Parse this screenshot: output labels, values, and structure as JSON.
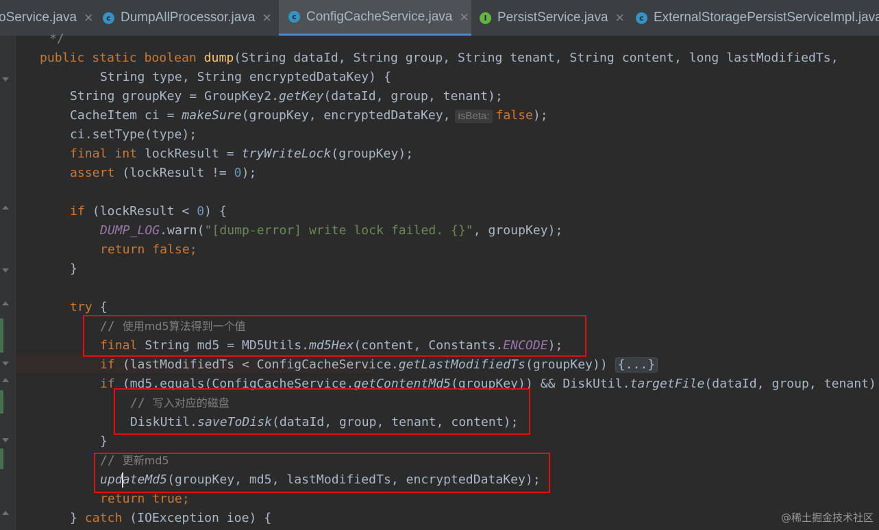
{
  "tabs": [
    {
      "name": "oService.java",
      "icon": "class-icon",
      "active": false
    },
    {
      "name": "DumpAllProcessor.java",
      "icon": "class-icon",
      "active": false
    },
    {
      "name": "ConfigCacheService.java",
      "icon": "class-icon",
      "active": true
    },
    {
      "name": "PersistService.java",
      "icon": "interface-icon",
      "active": false
    },
    {
      "name": "ExternalStoragePersistServiceImpl.java",
      "icon": "class-icon",
      "active": false
    }
  ],
  "icons": {
    "class_letter": "c",
    "interface_letter": "I",
    "close_glyph": "×"
  },
  "code": {
    "l0": "*/",
    "l1_kw": "public static boolean ",
    "l1_fn": "dump",
    "l1_rest": "(String dataId, String group, String tenant, String content, long lastModifiedTs,",
    "l2": "String type, String encryptedDataKey) {",
    "l3_a": "String groupKey = GroupKey2.",
    "l3_fn": "getKey",
    "l3_b": "(dataId, group, tenant);",
    "l4_a": "CacheItem ci = ",
    "l4_fn": "makeSure",
    "l4_b": "(groupKey, encryptedDataKey,",
    "l4_hint": "isBeta:",
    "l4_val": "false",
    "l4_end": ");",
    "l5": "ci.setType(type);",
    "l6_kw": "final int ",
    "l6_a": "lockResult = ",
    "l6_fn": "tryWriteLock",
    "l6_b": "(groupKey);",
    "l7_kw": "assert ",
    "l7_a": "(lockResult != ",
    "l7_num": "0",
    "l7_b": ");",
    "l8_kw": "if ",
    "l8_a": "(lockResult < ",
    "l8_num": "0",
    "l8_b": ") {",
    "l9_field": "DUMP_LOG",
    "l9_a": ".warn(",
    "l9_str": "\"[dump-error] write lock failed. {}\"",
    "l9_b": ", groupKey);",
    "l10_kw": "return false",
    "l10_b": ";",
    "l11": "}",
    "l12_kw": "try ",
    "l12_b": "{",
    "l13_cm": "// ",
    "l13_zh": "使用md5算法得到一个值",
    "l14_kw": "final ",
    "l14_a": "String md5 = MD5Utils.",
    "l14_fn": "md5Hex",
    "l14_b": "(content, Constants.",
    "l14_field": "ENCODE",
    "l14_c": ");",
    "l15_kw": "if ",
    "l15_a": "(lastModifiedTs < ConfigCacheService.",
    "l15_fn": "getLastModifiedTs",
    "l15_b": "(groupKey)) ",
    "l15_fold": "{...}",
    "l16_kw": "if ",
    "l16_a": "(md5.equals(ConfigCacheService.",
    "l16_fn": "getContentMd5",
    "l16_b": "(groupKey)) && DiskUtil.",
    "l16_fn2": "targetFile",
    "l16_c": "(dataId, group, tenant)",
    "l17_cm": "// ",
    "l17_zh": "写入对应的磁盘",
    "l18_a": "DiskUtil.",
    "l18_fn": "saveToDisk",
    "l18_b": "(dataId, group, tenant, content);",
    "l19": "}",
    "l20_cm": "// ",
    "l20_zh": "更新md5",
    "l21_fn_a": "upd",
    "l21_fn_b": "ateMd5",
    "l21_b": "(groupKey, md5, lastModifiedTs, encryptedDataKey);",
    "l22_kw": "return true",
    "l22_b": ";",
    "l23_a": "} ",
    "l23_kw": "catch ",
    "l23_b": "(IOException ioe) {"
  },
  "watermark": "@稀土掘金技术社区",
  "colors": {
    "highlight_box": "#e01010",
    "keyword": "#cc7832",
    "method": "#ffc66d",
    "comment": "#808080"
  }
}
